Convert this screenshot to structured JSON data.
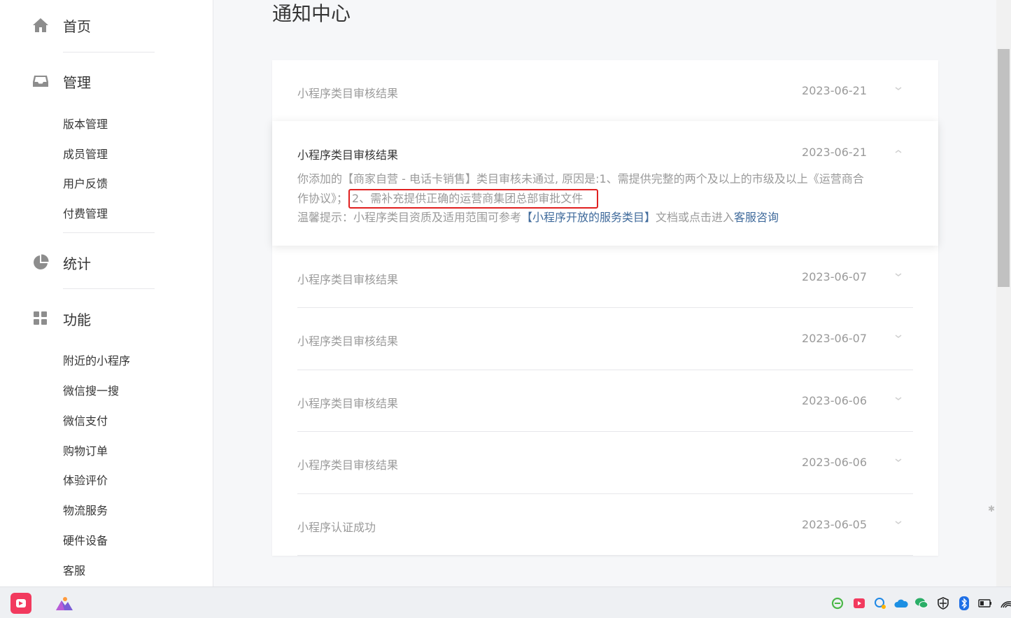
{
  "sidebar": {
    "home": {
      "label": "首页",
      "icon": "home-icon"
    },
    "manage": {
      "label": "管理",
      "icon": "inbox-icon",
      "items": [
        "版本管理",
        "成员管理",
        "用户反馈",
        "付费管理"
      ]
    },
    "stats": {
      "label": "统计",
      "icon": "pie-chart-icon"
    },
    "features": {
      "label": "功能",
      "icon": "grid-icon",
      "items": [
        "附近的小程序",
        "微信搜一搜",
        "微信支付",
        "购物订单",
        "体验评价",
        "物流服务",
        "硬件设备",
        "客服"
      ]
    }
  },
  "main": {
    "title": "通知中心",
    "notifications": [
      {
        "title": "小程序类目审核结果",
        "date": "2023-06-21",
        "expanded": false
      },
      {
        "title": "小程序类目审核结果",
        "date": "2023-06-21",
        "expanded": true
      },
      {
        "title": "小程序类目审核结果",
        "date": "2023-06-07",
        "expanded": false
      },
      {
        "title": "小程序类目审核结果",
        "date": "2023-06-07",
        "expanded": false
      },
      {
        "title": "小程序类目审核结果",
        "date": "2023-06-06",
        "expanded": false
      },
      {
        "title": "小程序类目审核结果",
        "date": "2023-06-06",
        "expanded": false
      },
      {
        "title": "小程序认证成功",
        "date": "2023-06-05",
        "expanded": false
      }
    ],
    "expanded_detail": {
      "body_part1": "你添加的【商家自营 - 电话卡销售】类目审核未通过, 原因是:1、需提供完整的两个及以上的市级及以上《运营商合作协议》；",
      "body_highlight": "2、需补充提供正确的运营商集团总部审批文件",
      "tip_prefix": "温馨提示：小程序类目资质及适用范围可参考",
      "tip_link": "【小程序开放的服务类目】",
      "tip_middle": "文档或点击进入",
      "tip_service_link": "客服咨询"
    }
  },
  "colors": {
    "link": "#3f6a9b",
    "highlight_border": "#e02020",
    "muted_text": "#9a9a9a",
    "text": "#353535"
  },
  "taskbar": {
    "apps": [
      "kuaishou-app-icon",
      "mountain-app-icon"
    ],
    "tray": [
      "ie-icon",
      "kuaishou-tray-icon",
      "chat-icon",
      "onedrive-icon",
      "wechat-icon",
      "shield-icon",
      "bluetooth-icon",
      "battery-icon",
      "wifi-icon"
    ]
  }
}
